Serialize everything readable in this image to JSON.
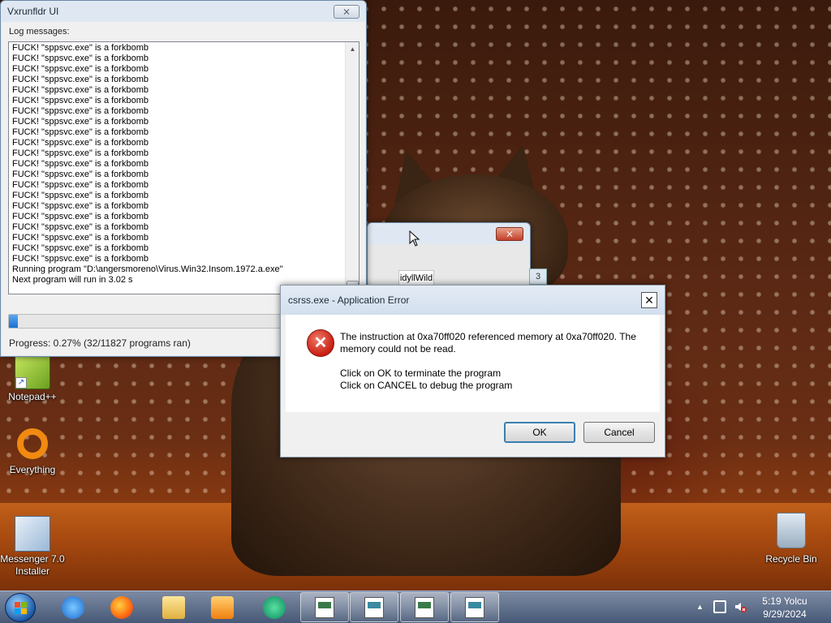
{
  "vx_window": {
    "title": "Vxrunfldr UI",
    "close_label": "⨯",
    "log_label": "Log messages:",
    "log_lines": [
      "FUCK! \"sppsvc.exe\" is a forkbomb",
      "FUCK! \"sppsvc.exe\" is a forkbomb",
      "FUCK! \"sppsvc.exe\" is a forkbomb",
      "FUCK! \"sppsvc.exe\" is a forkbomb",
      "FUCK! \"sppsvc.exe\" is a forkbomb",
      "FUCK! \"sppsvc.exe\" is a forkbomb",
      "FUCK! \"sppsvc.exe\" is a forkbomb",
      "FUCK! \"sppsvc.exe\" is a forkbomb",
      "FUCK! \"sppsvc.exe\" is a forkbomb",
      "FUCK! \"sppsvc.exe\" is a forkbomb",
      "FUCK! \"sppsvc.exe\" is a forkbomb",
      "FUCK! \"sppsvc.exe\" is a forkbomb",
      "FUCK! \"sppsvc.exe\" is a forkbomb",
      "FUCK! \"sppsvc.exe\" is a forkbomb",
      "FUCK! \"sppsvc.exe\" is a forkbomb",
      "FUCK! \"sppsvc.exe\" is a forkbomb",
      "FUCK! \"sppsvc.exe\" is a forkbomb",
      "FUCK! \"sppsvc.exe\" is a forkbomb",
      "FUCK! \"sppsvc.exe\" is a forkbomb",
      "FUCK! \"sppsvc.exe\" is a forkbomb",
      "FUCK! \"sppsvc.exe\" is a forkbomb",
      "Running program \"D:\\angersmoreno\\Virus.Win32.Insom.1972.a.exe\"",
      "Next program will run in 3.02 s"
    ],
    "progress_fraction": 0.0027,
    "progress_text": "Progress: 0.27% (32/11827 programs ran)"
  },
  "bg_window": {
    "tab_label": "idyllWild",
    "tab2_label": "3",
    "close_label": "⨯"
  },
  "error_dialog": {
    "title": "csrss.exe - Application Error",
    "close_label": "✕",
    "icon_glyph": "✕",
    "message_line1": "The instruction at 0xa70ff020 referenced memory at 0xa70ff020. The memory could not be read.",
    "message_line2": "Click on OK to terminate the program",
    "message_line3": "Click on CANCEL to debug the program",
    "ok_label": "OK",
    "cancel_label": "Cancel"
  },
  "desktop_icons": [
    {
      "label": "Notepad++",
      "icon": "notepadpp-icon"
    },
    {
      "label": "Everything",
      "icon": "everything-icon"
    },
    {
      "label": "Messenger 7.0 Installer",
      "icon": "messenger-installer-icon"
    },
    {
      "label": "Recycle Bin",
      "icon": "recycle-bin-icon"
    }
  ],
  "taskbar": {
    "pinned": [
      "internet-explorer-icon",
      "firefox-icon",
      "file-explorer-icon",
      "media-player-icon",
      "messenger-icon"
    ],
    "running_apps": [
      "app-window-icon",
      "app-window-icon",
      "app-window-icon",
      "app-window-icon"
    ],
    "tray_chevron": "▲",
    "clock_time": "5:19 Yolcu",
    "clock_date": "9/29/2024"
  },
  "colors": {
    "progress_fill": "#1e6fd0",
    "error_icon": "#c81e12",
    "taskbar": "#3c5a82"
  }
}
